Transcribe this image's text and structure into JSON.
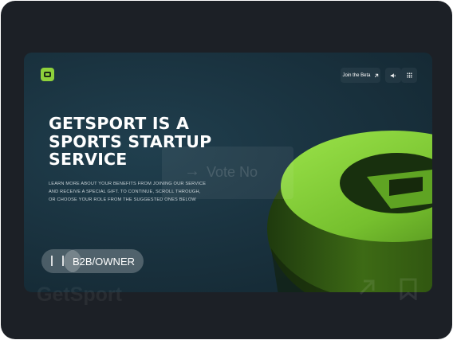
{
  "header": {
    "join_beta_label": "Join the Beta",
    "join_beta_icon": "arrow-up-right-icon",
    "sound_icon": "speaker-icon",
    "menu_icon": "grid-menu-icon",
    "logo_icon": "getsport-logo-icon"
  },
  "hero": {
    "headline_line1": "GETSPORT IS A",
    "headline_line2": "SPORTS STARTUP",
    "headline_line3": "SERVICE",
    "desc_line1": "LEARN MORE ABOUT YOUR BENEFITS FROM JOINING OUR SERVICE",
    "desc_line2": "AND RECEIVE A SPECIAL GIFT. TO CONTINUE, SCROLL THROUGH,",
    "desc_line3": "OR CHOOSE YOUR ROLE FROM THE SUGGESTED ONES BELOW"
  },
  "vote_overlay": {
    "arrow": "→",
    "label": "Vote No"
  },
  "roles": {
    "selected": "B2B/OWNER"
  },
  "footer": {
    "brand": "GetSport",
    "share_icon": "arrow-up-right-icon",
    "bookmark_icon": "bookmark-icon"
  },
  "colors": {
    "accent": "#8ed13b",
    "card_bg": "#1c2026",
    "hero_bg": "#1a3340"
  }
}
